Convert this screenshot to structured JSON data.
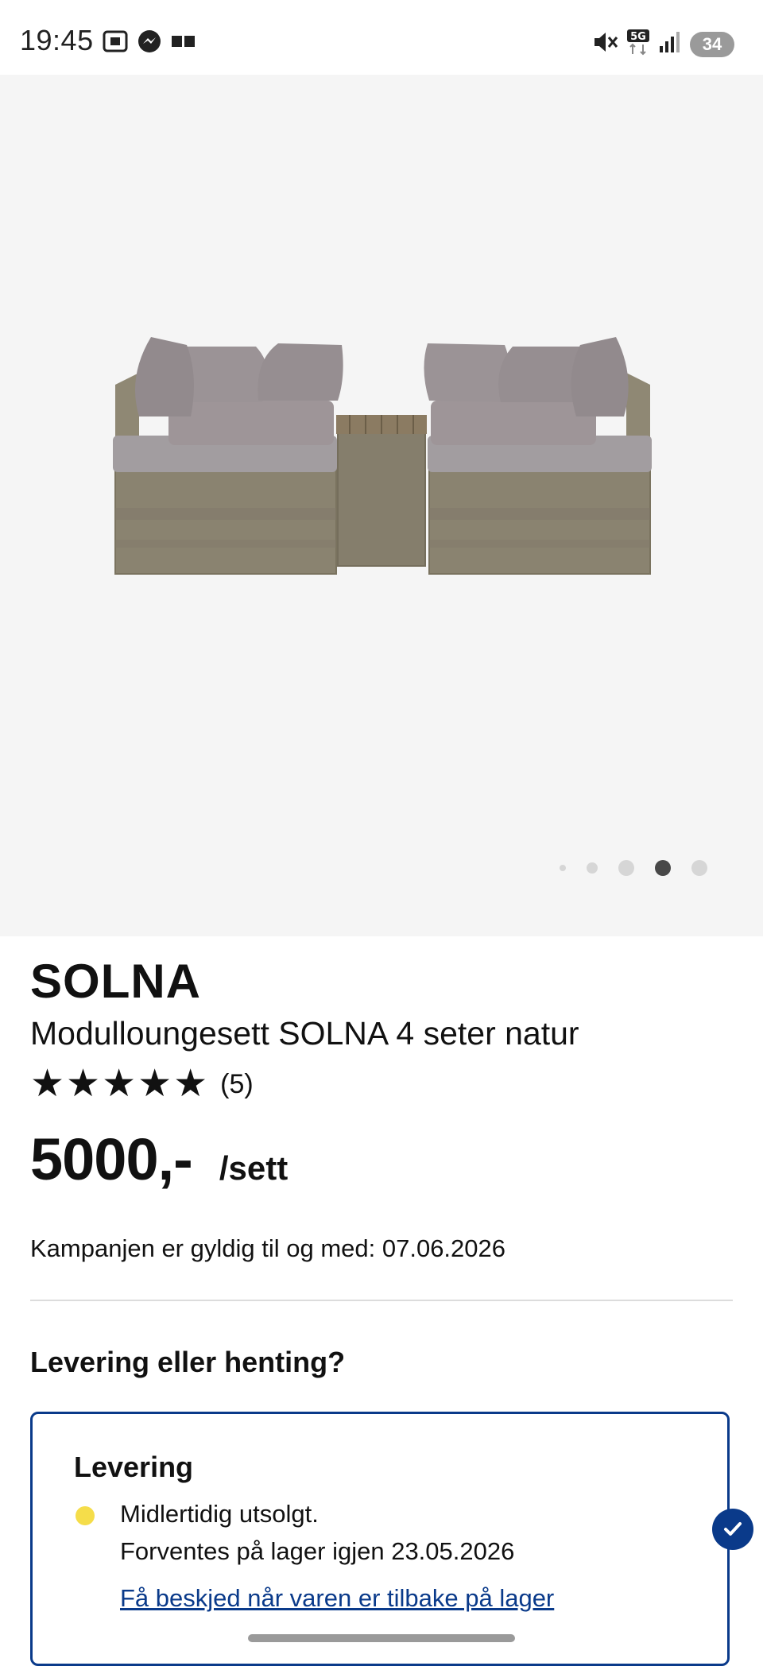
{
  "status_bar": {
    "time": "19:45",
    "left_icons": [
      "screenshot-icon",
      "messenger-icon",
      "sim-icon"
    ],
    "right_icons": [
      "mute-icon",
      "5g-icon",
      "signal-icon"
    ],
    "battery": "34"
  },
  "gallery": {
    "image": "sofa-lounge-set",
    "page_count": 5,
    "active_index": 3
  },
  "product": {
    "brand": "SOLNA",
    "subtitle": "Modulloungesett SOLNA 4 seter natur",
    "rating": 5,
    "rating_count": "(5)",
    "price": "5000,-",
    "unit": "/sett",
    "campaign": "Kampanjen er gyldig til og med: 07.06.2026"
  },
  "delivery": {
    "section_title": "Levering eller henting?",
    "card_title": "Levering",
    "status_line1": "Midlertidig utsolgt.",
    "status_line2": "Forventes på lager igjen 23.05.2026",
    "notify_link": "Få beskjed når varen er tilbake på lager",
    "status_color": "#f5dd4a",
    "accent_color": "#0a3a8a"
  }
}
